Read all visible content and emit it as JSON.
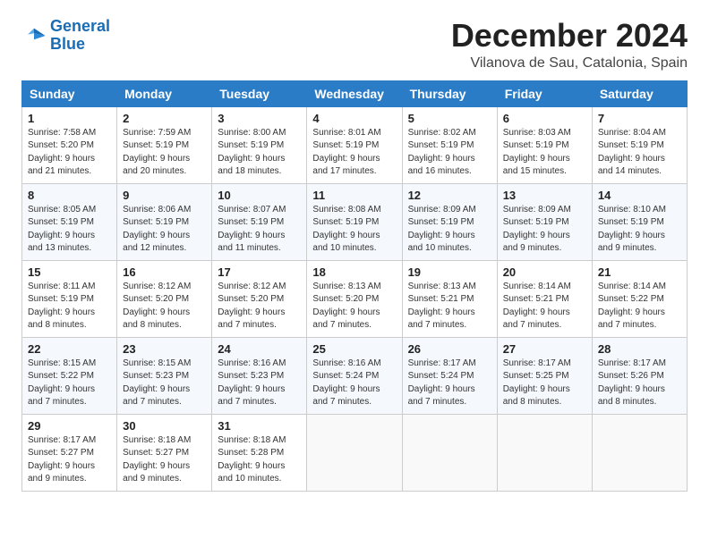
{
  "logo": {
    "line1": "General",
    "line2": "Blue"
  },
  "header": {
    "month": "December 2024",
    "location": "Vilanova de Sau, Catalonia, Spain"
  },
  "weekdays": [
    "Sunday",
    "Monday",
    "Tuesday",
    "Wednesday",
    "Thursday",
    "Friday",
    "Saturday"
  ],
  "weeks": [
    [
      {
        "day": "1",
        "sunrise": "7:58 AM",
        "sunset": "5:20 PM",
        "daylight": "9 hours and 21 minutes."
      },
      {
        "day": "2",
        "sunrise": "7:59 AM",
        "sunset": "5:19 PM",
        "daylight": "9 hours and 20 minutes."
      },
      {
        "day": "3",
        "sunrise": "8:00 AM",
        "sunset": "5:19 PM",
        "daylight": "9 hours and 18 minutes."
      },
      {
        "day": "4",
        "sunrise": "8:01 AM",
        "sunset": "5:19 PM",
        "daylight": "9 hours and 17 minutes."
      },
      {
        "day": "5",
        "sunrise": "8:02 AM",
        "sunset": "5:19 PM",
        "daylight": "9 hours and 16 minutes."
      },
      {
        "day": "6",
        "sunrise": "8:03 AM",
        "sunset": "5:19 PM",
        "daylight": "9 hours and 15 minutes."
      },
      {
        "day": "7",
        "sunrise": "8:04 AM",
        "sunset": "5:19 PM",
        "daylight": "9 hours and 14 minutes."
      }
    ],
    [
      {
        "day": "8",
        "sunrise": "8:05 AM",
        "sunset": "5:19 PM",
        "daylight": "9 hours and 13 minutes."
      },
      {
        "day": "9",
        "sunrise": "8:06 AM",
        "sunset": "5:19 PM",
        "daylight": "9 hours and 12 minutes."
      },
      {
        "day": "10",
        "sunrise": "8:07 AM",
        "sunset": "5:19 PM",
        "daylight": "9 hours and 11 minutes."
      },
      {
        "day": "11",
        "sunrise": "8:08 AM",
        "sunset": "5:19 PM",
        "daylight": "9 hours and 10 minutes."
      },
      {
        "day": "12",
        "sunrise": "8:09 AM",
        "sunset": "5:19 PM",
        "daylight": "9 hours and 10 minutes."
      },
      {
        "day": "13",
        "sunrise": "8:09 AM",
        "sunset": "5:19 PM",
        "daylight": "9 hours and 9 minutes."
      },
      {
        "day": "14",
        "sunrise": "8:10 AM",
        "sunset": "5:19 PM",
        "daylight": "9 hours and 9 minutes."
      }
    ],
    [
      {
        "day": "15",
        "sunrise": "8:11 AM",
        "sunset": "5:19 PM",
        "daylight": "9 hours and 8 minutes."
      },
      {
        "day": "16",
        "sunrise": "8:12 AM",
        "sunset": "5:20 PM",
        "daylight": "9 hours and 8 minutes."
      },
      {
        "day": "17",
        "sunrise": "8:12 AM",
        "sunset": "5:20 PM",
        "daylight": "9 hours and 7 minutes."
      },
      {
        "day": "18",
        "sunrise": "8:13 AM",
        "sunset": "5:20 PM",
        "daylight": "9 hours and 7 minutes."
      },
      {
        "day": "19",
        "sunrise": "8:13 AM",
        "sunset": "5:21 PM",
        "daylight": "9 hours and 7 minutes."
      },
      {
        "day": "20",
        "sunrise": "8:14 AM",
        "sunset": "5:21 PM",
        "daylight": "9 hours and 7 minutes."
      },
      {
        "day": "21",
        "sunrise": "8:14 AM",
        "sunset": "5:22 PM",
        "daylight": "9 hours and 7 minutes."
      }
    ],
    [
      {
        "day": "22",
        "sunrise": "8:15 AM",
        "sunset": "5:22 PM",
        "daylight": "9 hours and 7 minutes."
      },
      {
        "day": "23",
        "sunrise": "8:15 AM",
        "sunset": "5:23 PM",
        "daylight": "9 hours and 7 minutes."
      },
      {
        "day": "24",
        "sunrise": "8:16 AM",
        "sunset": "5:23 PM",
        "daylight": "9 hours and 7 minutes."
      },
      {
        "day": "25",
        "sunrise": "8:16 AM",
        "sunset": "5:24 PM",
        "daylight": "9 hours and 7 minutes."
      },
      {
        "day": "26",
        "sunrise": "8:17 AM",
        "sunset": "5:24 PM",
        "daylight": "9 hours and 7 minutes."
      },
      {
        "day": "27",
        "sunrise": "8:17 AM",
        "sunset": "5:25 PM",
        "daylight": "9 hours and 8 minutes."
      },
      {
        "day": "28",
        "sunrise": "8:17 AM",
        "sunset": "5:26 PM",
        "daylight": "9 hours and 8 minutes."
      }
    ],
    [
      {
        "day": "29",
        "sunrise": "8:17 AM",
        "sunset": "5:27 PM",
        "daylight": "9 hours and 9 minutes."
      },
      {
        "day": "30",
        "sunrise": "8:18 AM",
        "sunset": "5:27 PM",
        "daylight": "9 hours and 9 minutes."
      },
      {
        "day": "31",
        "sunrise": "8:18 AM",
        "sunset": "5:28 PM",
        "daylight": "9 hours and 10 minutes."
      },
      null,
      null,
      null,
      null
    ]
  ],
  "labels": {
    "sunrise": "Sunrise:",
    "sunset": "Sunset:",
    "daylight": "Daylight:"
  }
}
